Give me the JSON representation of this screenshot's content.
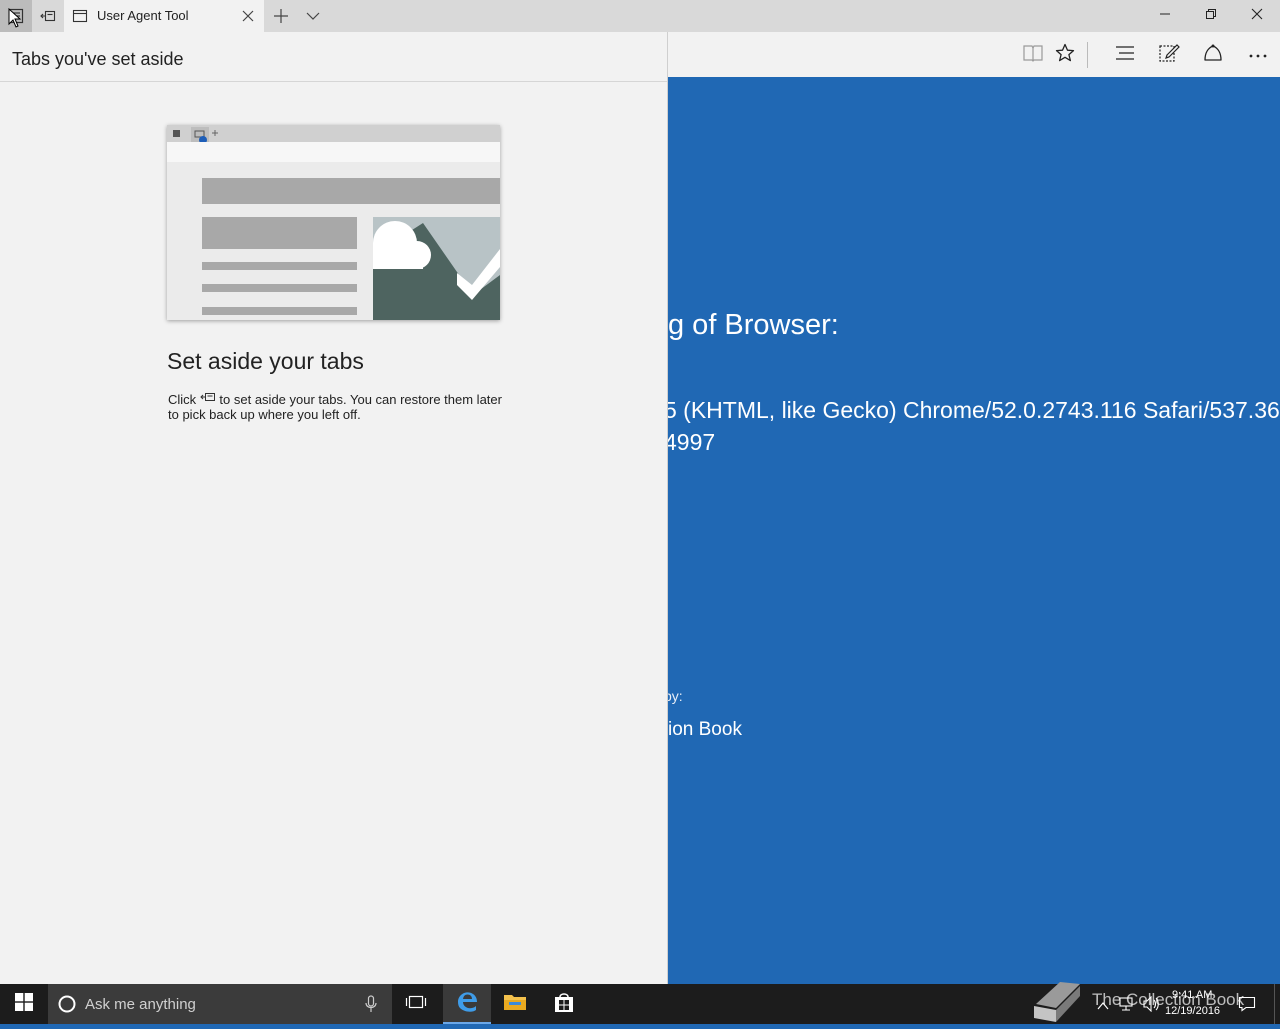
{
  "tabbar": {
    "active_tab_title": "User Agent Tool",
    "icons": [
      "set-aside-tabs-view-icon",
      "set-aside-tabs-icon",
      "new-tab-icon",
      "tab-preview-chevron-icon"
    ]
  },
  "window_controls": [
    "minimize-icon",
    "restore-icon",
    "close-icon"
  ],
  "toolbar": {
    "icons": [
      "reading-view-icon",
      "favorites-star-icon",
      "hub-icon",
      "web-note-icon",
      "share-icon",
      "more-icon"
    ]
  },
  "page": {
    "heading": "g of Browser:",
    "ua_line1": "5 (KHTML, like Gecko) Chrome/52.0.2743.116 Safari/537.36",
    "ua_line2": "4997",
    "by_label": "by:",
    "author": "ion Book",
    "background_color": "#2068b4"
  },
  "side_panel": {
    "title": "Tabs you've set aside",
    "empty_title": "Set aside your tabs",
    "desc_click": "Click",
    "desc_rest": "to set aside your tabs. You can restore them later to pick back up where you left off."
  },
  "taskbar": {
    "search_placeholder": "Ask me anything",
    "clock_time": "9:41 AM",
    "clock_date": "12/19/2016",
    "watermark": "The Collection Book"
  }
}
